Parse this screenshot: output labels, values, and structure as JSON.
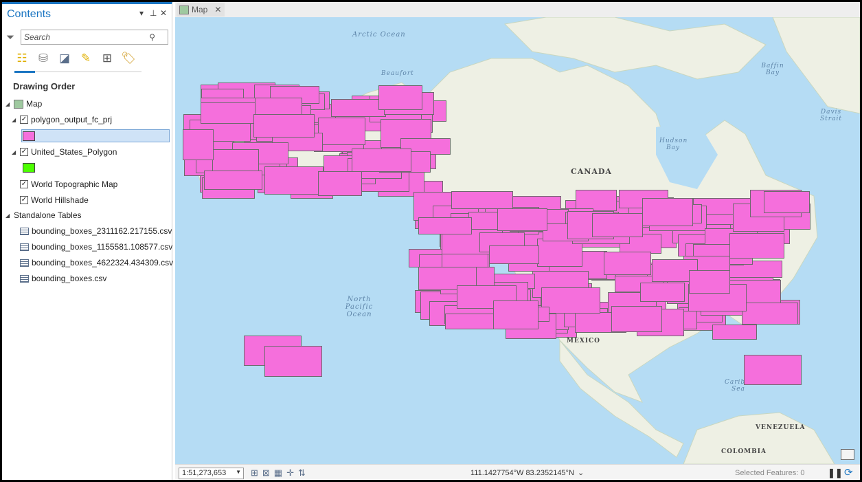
{
  "panel": {
    "title": "Contents",
    "search_placeholder": "Search",
    "heading": "Drawing Order",
    "map_item": "Map",
    "layers": [
      {
        "name": "polygon_output_fc_prj",
        "checked": true,
        "color": "#f56fdc"
      },
      {
        "name": "United_States_Polygon",
        "checked": true,
        "color": "#4cff00"
      },
      {
        "name": "World Topographic Map",
        "checked": true
      },
      {
        "name": "World Hillshade",
        "checked": true
      }
    ],
    "standalone_heading": "Standalone Tables",
    "tables": [
      "bounding_boxes_2311162.217155.csv",
      "bounding_boxes_1155581.108577.csv",
      "bounding_boxes_4622324.434309.csv",
      "bounding_boxes.csv"
    ]
  },
  "map": {
    "tab": "Map",
    "labels": {
      "arctic": "Arctic Ocean",
      "beaufort": "Beaufort",
      "baffin": "Baffin Bay",
      "davis": "Davis Strait",
      "hudson": "Hudson Bay",
      "canada": "CANADA",
      "pacific": "North Pacific Ocean",
      "mexico": "MEXICO",
      "caribbean": "Caribbean Sea",
      "venezuela": "VENEZUELA",
      "colombia": "COLOMBIA"
    },
    "ocean_color": "#b5dcf4",
    "land_color": "#eef0e4"
  },
  "status": {
    "scale": "1:51,273,653",
    "coords": "111.1427754°W 83.2352145°N",
    "selected": "Selected Features: 0"
  }
}
